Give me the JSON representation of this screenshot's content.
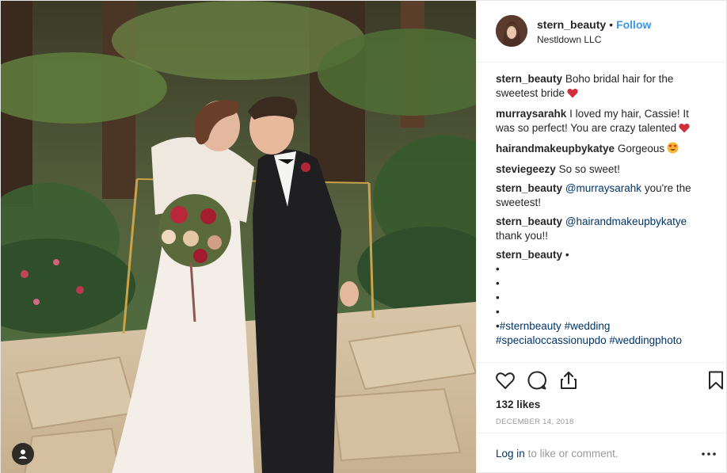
{
  "header": {
    "username": "stern_beauty",
    "separator": "•",
    "follow_label": "Follow",
    "location": "Nestldown LLC"
  },
  "comments": [
    {
      "user": "stern_beauty",
      "text": "Boho bridal hair for the sweetest bride",
      "emoji": "red-heart"
    },
    {
      "user": "murraysarahk",
      "text": "I loved my hair, Cassie! It was so perfect! You are crazy talented",
      "emoji": "red-heart"
    },
    {
      "user": "hairandmakeupbykatye",
      "text": "Gorgeous",
      "emoji": "heart-eyes"
    },
    {
      "user": "steviegeezy",
      "text": "So so sweet!"
    },
    {
      "user": "stern_beauty",
      "mention": "@murraysarahk",
      "text": "you're the sweetest!"
    },
    {
      "user": "stern_beauty",
      "mention": "@hairandmakeupbykatye",
      "text": "thank you!!"
    },
    {
      "user": "stern_beauty",
      "text": "•",
      "dots": [
        "•",
        "•",
        "•",
        "•",
        "•"
      ],
      "hashtags": [
        "#sternbeauty",
        "#wedding",
        "#specialoccassionupdo",
        "#weddingphoto"
      ]
    }
  ],
  "actions": {
    "likes": "132 likes",
    "date": "December 14, 2018",
    "login_link": "Log in",
    "login_rest": "to like or comment."
  },
  "icons": [
    "user-tag-icon",
    "heart-icon",
    "comment-icon",
    "share-icon",
    "bookmark-icon",
    "more-options-icon"
  ],
  "colors": {
    "link_blue": "#3897f0",
    "mention_blue": "#003569",
    "muted": "#999999",
    "text": "#262626"
  }
}
